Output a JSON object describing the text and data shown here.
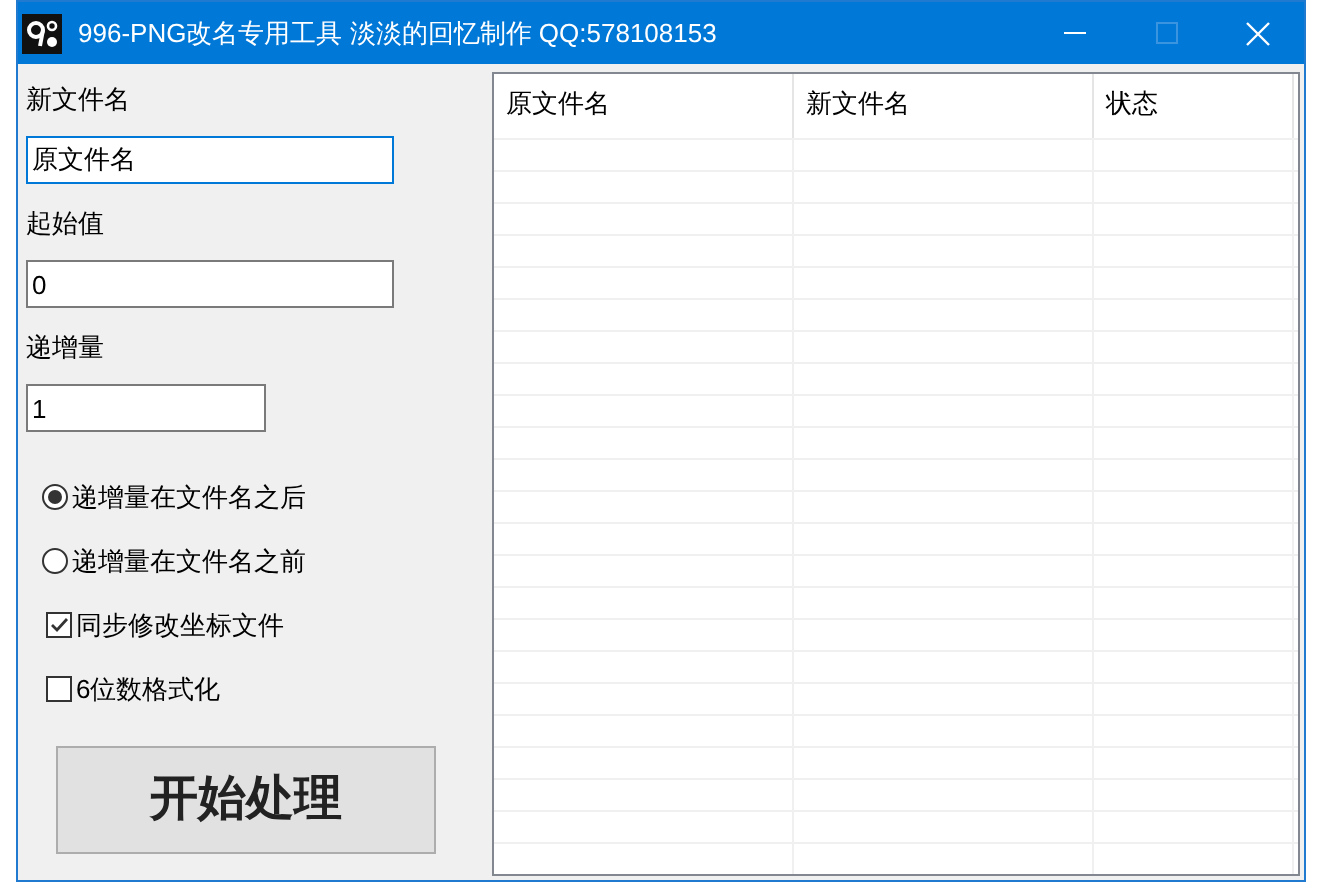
{
  "window": {
    "title": "996-PNG改名专用工具 淡淡的回忆制作 QQ:578108153",
    "maximize_disabled": true
  },
  "fields": [
    {
      "label": "新文件名",
      "value": "原文件名",
      "focused": true,
      "wide": true
    },
    {
      "label": "起始值",
      "value": "0",
      "focused": false,
      "wide": true
    },
    {
      "label": "递增量",
      "value": "1",
      "focused": false,
      "wide": false
    }
  ],
  "options": [
    {
      "kind": "radio",
      "label": "递增量在文件名之后",
      "selected": true
    },
    {
      "kind": "radio",
      "label": "递增量在文件名之前",
      "selected": false
    },
    {
      "kind": "checkbox",
      "label": "同步修改坐标文件",
      "checked": true
    },
    {
      "kind": "checkbox",
      "label": "6位数格式化",
      "checked": false
    }
  ],
  "start_button": "开始处理",
  "table": {
    "columns": [
      "原文件名",
      "新文件名",
      "状态"
    ]
  }
}
